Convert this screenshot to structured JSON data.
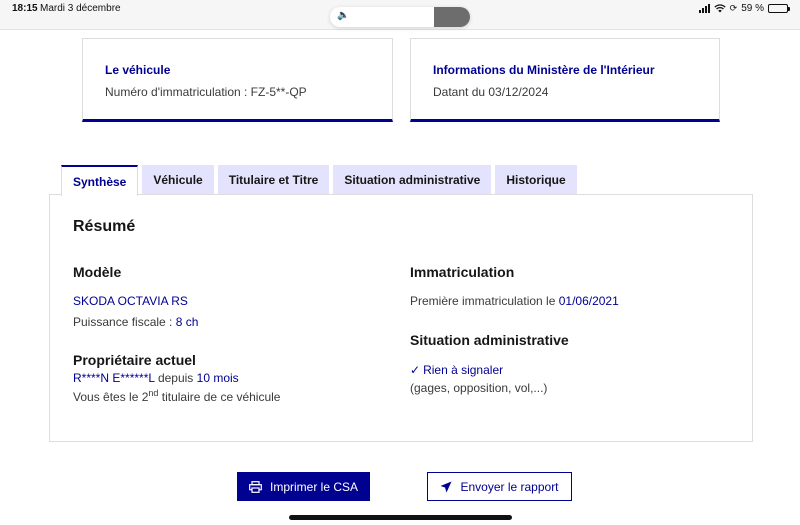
{
  "status_bar": {
    "time": "18:15",
    "date": "Mardi 3 décembre",
    "battery_text": "59 %",
    "battery_level": 0.59
  },
  "cards": {
    "vehicle": {
      "title": "Le véhicule",
      "text": "Numéro d'immatriculation : FZ-5**-QP"
    },
    "ministry": {
      "title": "Informations du Ministère de l'Intérieur",
      "text": "Datant du 03/12/2024"
    }
  },
  "tabs": [
    {
      "label": "Synthèse",
      "active": true
    },
    {
      "label": "Véhicule",
      "active": false
    },
    {
      "label": "Titulaire et Titre",
      "active": false
    },
    {
      "label": "Situation administrative",
      "active": false
    },
    {
      "label": "Historique",
      "active": false
    }
  ],
  "summary": {
    "title": "Résumé",
    "model": {
      "heading": "Modèle",
      "name": "SKODA OCTAVIA RS",
      "power_label": "Puissance fiscale : ",
      "power_value": "8 ch"
    },
    "owner": {
      "heading": "Propriétaire actuel",
      "name": "R****N E******L",
      "since_label": " depuis ",
      "since_value": "10 mois",
      "holder_prefix": "Vous êtes le 2",
      "holder_sup": "nd",
      "holder_suffix": " titulaire de ce véhicule"
    },
    "registration": {
      "heading": "Immatriculation",
      "first_label": "Première immatriculation le ",
      "first_date": "01/06/2021"
    },
    "admin": {
      "heading": "Situation administrative",
      "status": "Rien à signaler",
      "details": "(gages, opposition, vol,...)"
    }
  },
  "actions": {
    "print_label": "Imprimer le CSA",
    "send_label": "Envoyer le rapport"
  },
  "colors": {
    "accent": "#000091",
    "tab_inactive": "#e3e3fd"
  }
}
